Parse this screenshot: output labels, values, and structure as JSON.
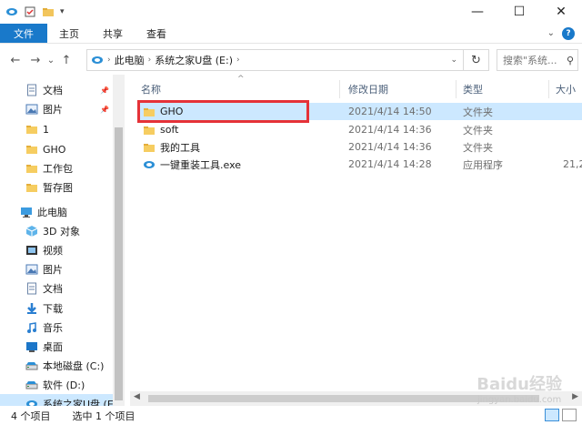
{
  "ribbon": {
    "file": "文件",
    "home": "主页",
    "share": "共享",
    "view": "查看"
  },
  "window_controls": {
    "minimize": "—",
    "maximize": "☐",
    "close": "✕"
  },
  "nav_buttons": {
    "back": "←",
    "forward": "→",
    "recent": "⌄",
    "up": "↑"
  },
  "address": {
    "crumb1": "此电脑",
    "crumb2": "系统之家U盘 (E:)",
    "refresh": "↻"
  },
  "search": {
    "placeholder": "搜索\"系统...",
    "icon": "search-icon"
  },
  "nav_pane": {
    "items": [
      {
        "label": "文档",
        "icon": "document-icon",
        "pinned": true
      },
      {
        "label": "图片",
        "icon": "pictures-icon",
        "pinned": true
      },
      {
        "label": "1",
        "icon": "folder-icon"
      },
      {
        "label": "GHO",
        "icon": "folder-icon"
      },
      {
        "label": "工作包",
        "icon": "folder-icon"
      },
      {
        "label": "暂存图",
        "icon": "folder-icon"
      },
      {
        "label": "此电脑",
        "icon": "computer-icon"
      },
      {
        "label": "3D 对象",
        "icon": "3d-objects-icon"
      },
      {
        "label": "视频",
        "icon": "video-icon"
      },
      {
        "label": "图片",
        "icon": "pictures-icon"
      },
      {
        "label": "文档",
        "icon": "document-icon"
      },
      {
        "label": "下载",
        "icon": "download-icon"
      },
      {
        "label": "音乐",
        "icon": "music-icon"
      },
      {
        "label": "桌面",
        "icon": "desktop-icon"
      },
      {
        "label": "本地磁盘 (C:)",
        "icon": "drive-icon"
      },
      {
        "label": "软件 (D:)",
        "icon": "drive-icon"
      },
      {
        "label": "系统之家U盘 (E:)",
        "icon": "usb-drive-icon"
      }
    ]
  },
  "columns": {
    "name": "名称",
    "modified": "修改日期",
    "type": "类型",
    "size": "大小"
  },
  "files": [
    {
      "name": "GHO",
      "modified": "2021/4/14 14:50",
      "type": "文件夹",
      "size": "",
      "icon": "folder-icon"
    },
    {
      "name": "soft",
      "modified": "2021/4/14 14:36",
      "type": "文件夹",
      "size": "",
      "icon": "folder-icon"
    },
    {
      "name": "我的工具",
      "modified": "2021/4/14 14:36",
      "type": "文件夹",
      "size": "",
      "icon": "folder-icon"
    },
    {
      "name": "一键重装工具.exe",
      "modified": "2021/4/14 14:28",
      "type": "应用程序",
      "size": "21,2",
      "icon": "app-icon"
    }
  ],
  "status": {
    "count": "4 个项目",
    "selected": "选中 1 个项目"
  },
  "watermark": {
    "brand": "Baidu经验",
    "url": "jingyan.baidu.com"
  }
}
